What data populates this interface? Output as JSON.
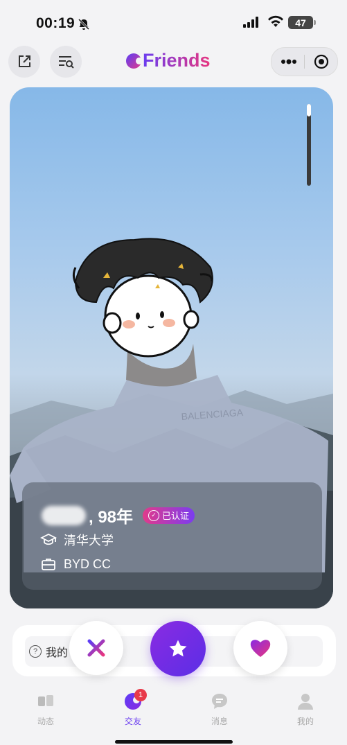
{
  "status_bar": {
    "time": "00:19",
    "battery": "47"
  },
  "header": {
    "logo": "Friends"
  },
  "profile": {
    "name_year": ", 98年",
    "verified": "已认证",
    "school": "清华大学",
    "job": "BYD CC",
    "shirt_text": "BALENCIAGA"
  },
  "prompt": {
    "text": "我的"
  },
  "tabs": [
    {
      "label": "动态",
      "icon": "moments-icon"
    },
    {
      "label": "交友",
      "icon": "friends-icon",
      "badge": "1",
      "active": true
    },
    {
      "label": "消息",
      "icon": "message-icon"
    },
    {
      "label": "我的",
      "icon": "profile-icon"
    }
  ],
  "colors": {
    "accent": "#6a3cf0",
    "pink": "#e8367f",
    "badge": "#e83a4a"
  }
}
